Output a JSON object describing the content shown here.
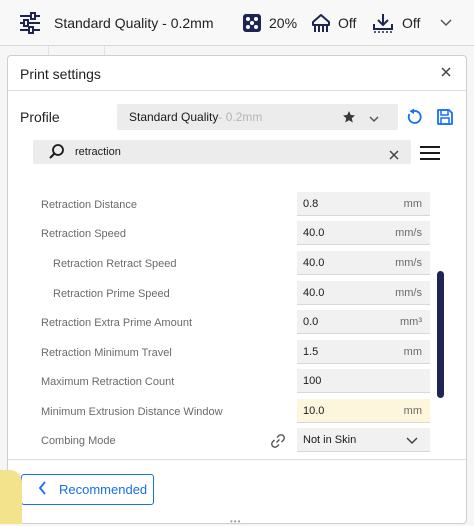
{
  "toolbar": {
    "quality_label": "Standard Quality - 0.2mm",
    "infill_value": "20%",
    "support_value": "Off",
    "adhesion_value": "Off",
    "icons": [
      "settings-sliders-icon",
      "infill-icon",
      "support-icon",
      "adhesion-icon",
      "chevron-down-icon"
    ]
  },
  "panel": {
    "title": "Print settings",
    "profile_label": "Profile",
    "profile_name": "Standard Quality",
    "profile_sub": " - 0.2mm",
    "search_value": "retraction",
    "settings": [
      {
        "label": "Retraction Distance",
        "value": "0.8",
        "unit": "mm"
      },
      {
        "label": "Retraction Speed",
        "value": "40.0",
        "unit": "mm/s"
      },
      {
        "label": "Retraction Retract Speed",
        "value": "40.0",
        "unit": "mm/s"
      },
      {
        "label": "Retraction Prime Speed",
        "value": "40.0",
        "unit": "mm/s"
      },
      {
        "label": "Retraction Extra Prime Amount",
        "value": "0.0",
        "unit": "mm³"
      },
      {
        "label": "Retraction Minimum Travel",
        "value": "1.5",
        "unit": "mm"
      },
      {
        "label": "Maximum Retraction Count",
        "value": "100",
        "unit": ""
      },
      {
        "label": "Minimum Extrusion Distance Window",
        "value": "10.0",
        "unit": "mm"
      },
      {
        "label": "Combing Mode",
        "value": "Not in Skin",
        "unit": ""
      }
    ],
    "recommended_label": "Recommended"
  },
  "colors": {
    "accent": "#196ef0",
    "scrollbar": "#1e2454",
    "highlight": "#fdf5dc"
  }
}
